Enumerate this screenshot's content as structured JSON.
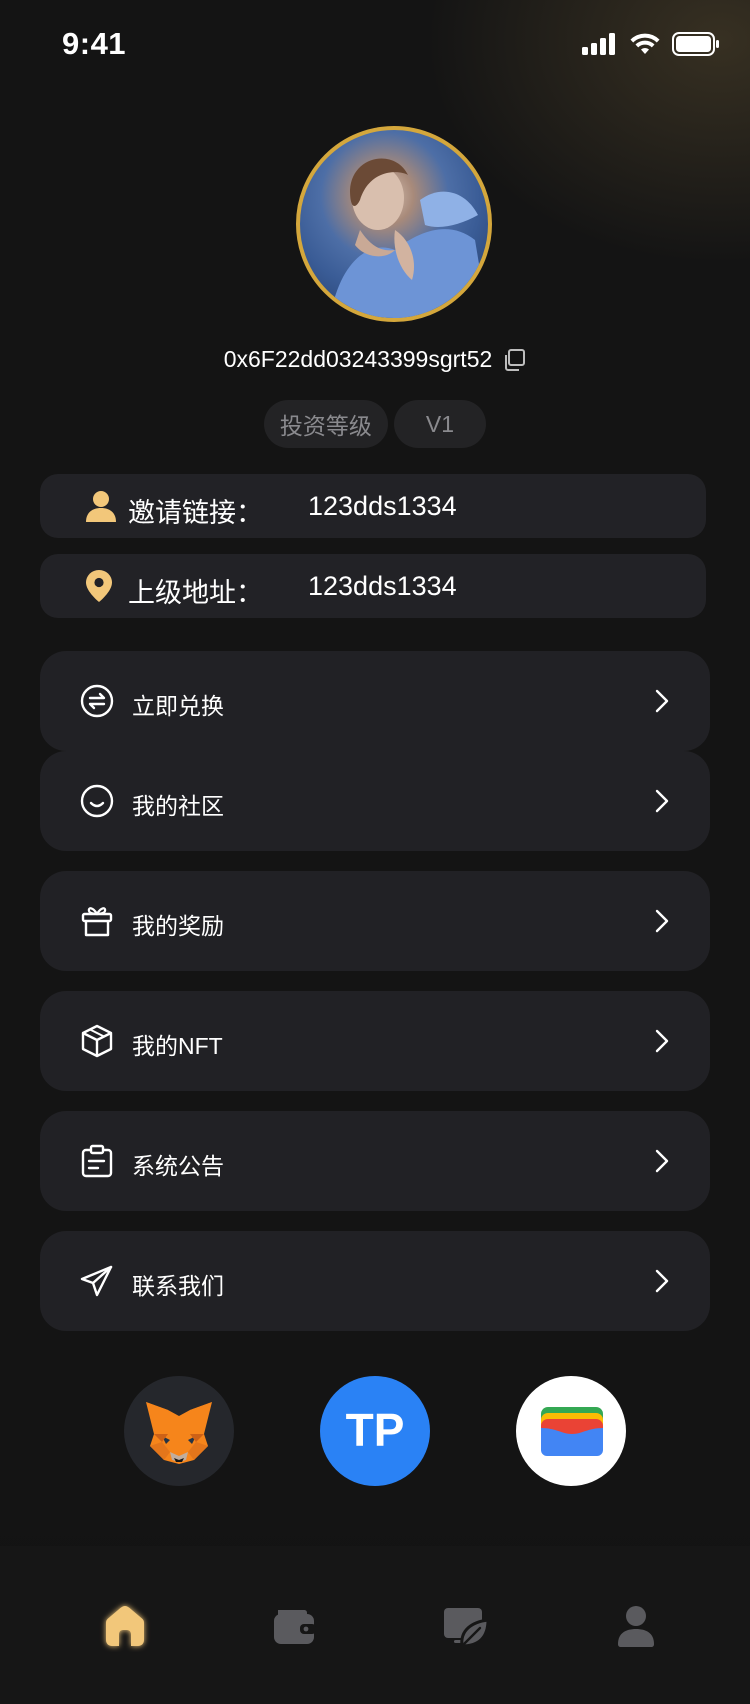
{
  "status_bar": {
    "time": "9:41"
  },
  "profile": {
    "address": "0x6F22dd03243399sgrt52",
    "level_label": "投资等级",
    "level_value": "V1"
  },
  "info": {
    "invite_label": "邀请链接：",
    "invite_value": "123dds1334",
    "parent_label": "上级地址：",
    "parent_value": "123dds1334"
  },
  "menu": [
    {
      "label": "立即兑换",
      "icon": "exchange-icon"
    },
    {
      "label": "我的社区",
      "icon": "smile-icon"
    },
    {
      "label": "我的奖励",
      "icon": "gift-icon"
    },
    {
      "label": "我的NFT",
      "icon": "cube-icon"
    },
    {
      "label": "系统公告",
      "icon": "notice-icon"
    },
    {
      "label": "联系我们",
      "icon": "send-icon"
    }
  ],
  "wallets": [
    {
      "icon": "metamask-icon"
    },
    {
      "icon": "tokenpocket-icon",
      "text": "TP"
    },
    {
      "icon": "wallet-app-icon"
    }
  ],
  "tab_bar": {
    "active": "home",
    "tabs": [
      "home-icon",
      "wallet-icon",
      "nft-leaf-icon",
      "profile-icon"
    ]
  },
  "colors": {
    "accent": "#f2c77a",
    "avatar_ring": "#d4a73c",
    "card": "#212125",
    "tp_blue": "#2a82f5"
  }
}
